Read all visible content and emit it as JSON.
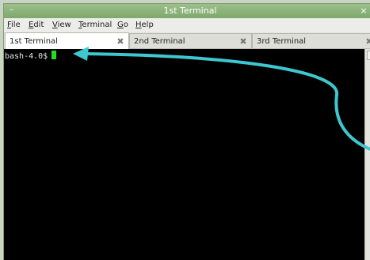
{
  "window": {
    "title": "1st Terminal",
    "menu_button": "–",
    "close_button": "×"
  },
  "menubar": {
    "items": [
      {
        "mnemonic": "F",
        "rest": "ile"
      },
      {
        "mnemonic": "E",
        "rest": "dit"
      },
      {
        "mnemonic": "V",
        "rest": "iew"
      },
      {
        "mnemonic": "T",
        "rest": "erminal"
      },
      {
        "mnemonic": "G",
        "rest": "o"
      },
      {
        "mnemonic": "H",
        "rest": "elp"
      }
    ]
  },
  "tabs": [
    {
      "label": "1st Terminal",
      "close": "✖",
      "active": true
    },
    {
      "label": "2nd Terminal",
      "close": "✖",
      "active": false
    },
    {
      "label": "3rd Terminal",
      "close": "✖",
      "active": false
    }
  ],
  "terminal": {
    "prompt": "bash-4.0$"
  },
  "colors": {
    "titlebar": "#8ab47a",
    "terminal_bg": "#000000",
    "cursor": "#22dd22",
    "annotation_arrow": "#3ec7cf"
  },
  "icons": {
    "window_menu": "window-menu-icon",
    "close": "close-icon",
    "tab_close": "tab-close-icon",
    "annotation": "annotation-arrow-icon"
  }
}
